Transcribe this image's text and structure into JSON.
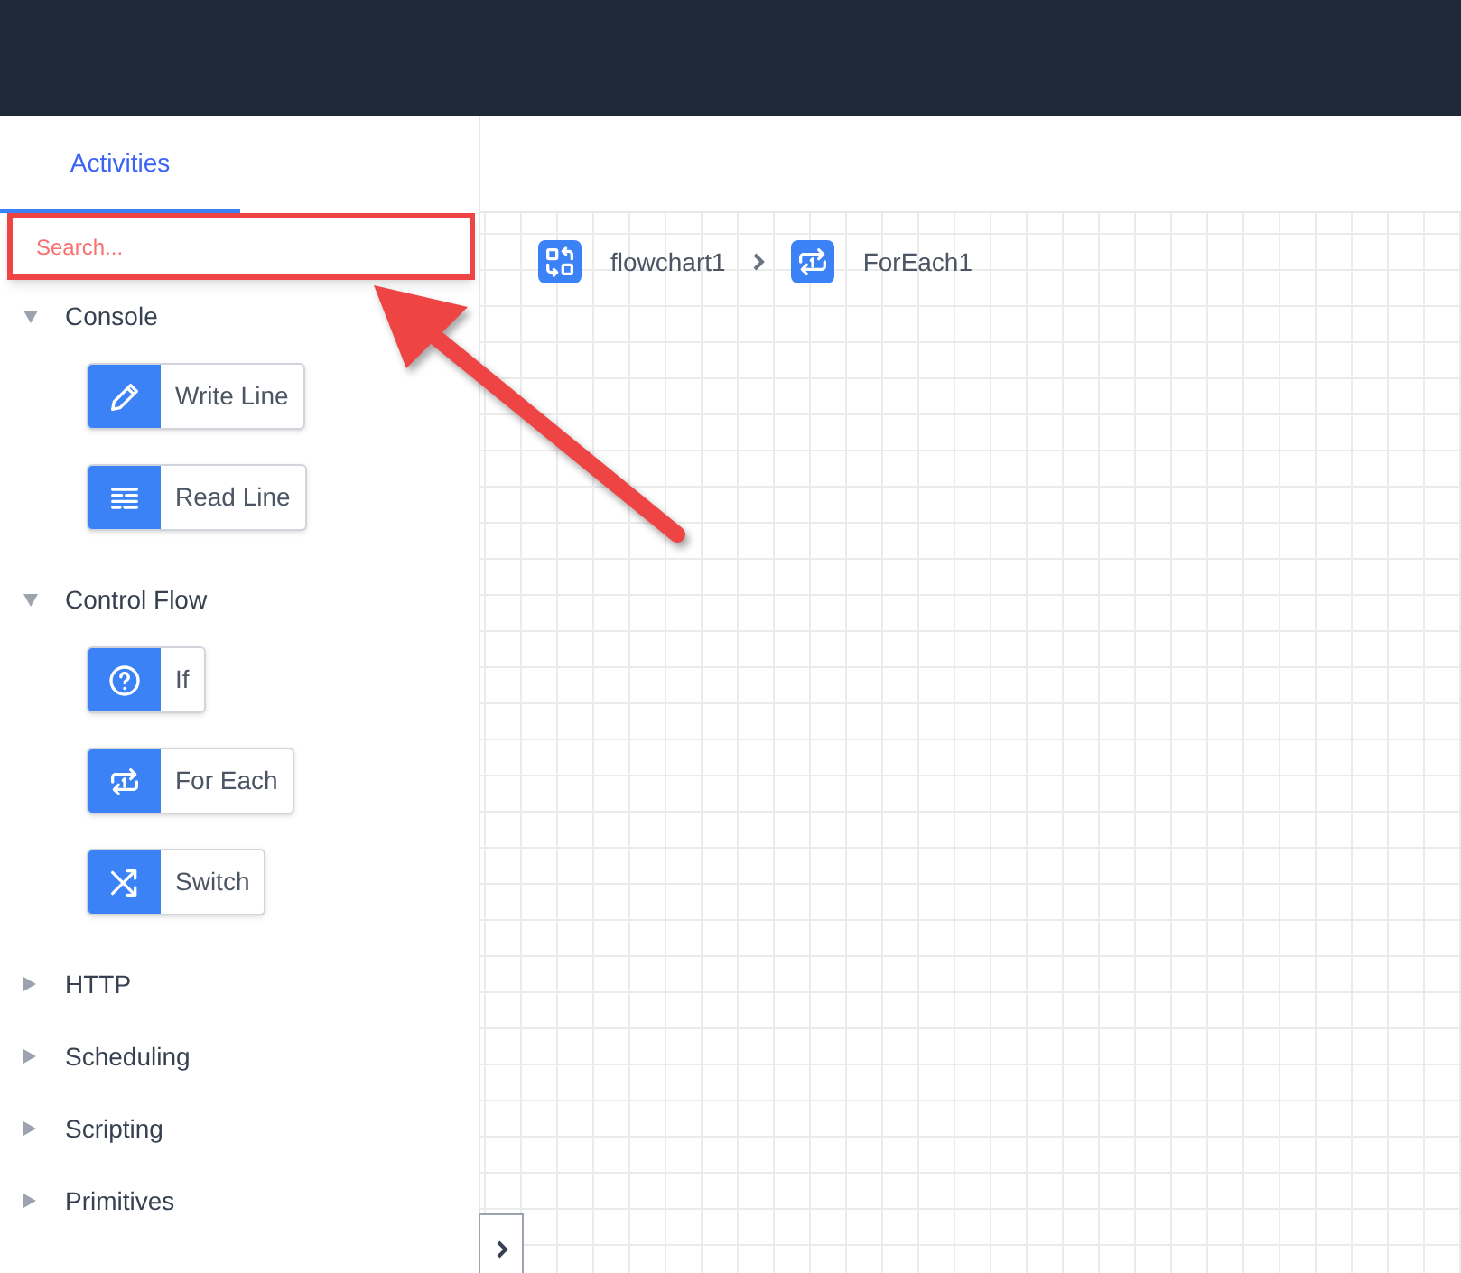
{
  "tabs": [
    {
      "label": "Activities",
      "selected": true
    }
  ],
  "search": {
    "placeholder": "Search..."
  },
  "categories": [
    {
      "label": "Console",
      "expanded": true,
      "activities": [
        {
          "label": "Write Line",
          "kind": "write"
        },
        {
          "label": "Read Line",
          "kind": "read"
        }
      ]
    },
    {
      "label": "Control Flow",
      "expanded": true,
      "activities": [
        {
          "label": "If",
          "kind": "if"
        },
        {
          "label": "For Each",
          "kind": "foreach"
        },
        {
          "label": "Switch",
          "kind": "switch"
        }
      ]
    },
    {
      "label": "HTTP",
      "expanded": false
    },
    {
      "label": "Scheduling",
      "expanded": false
    },
    {
      "label": "Scripting",
      "expanded": false
    },
    {
      "label": "Primitives",
      "expanded": false
    }
  ],
  "breadcrumb": [
    {
      "label": "flowchart1",
      "kind": "flowchart"
    },
    {
      "label": "ForEach1",
      "kind": "foreach"
    }
  ]
}
